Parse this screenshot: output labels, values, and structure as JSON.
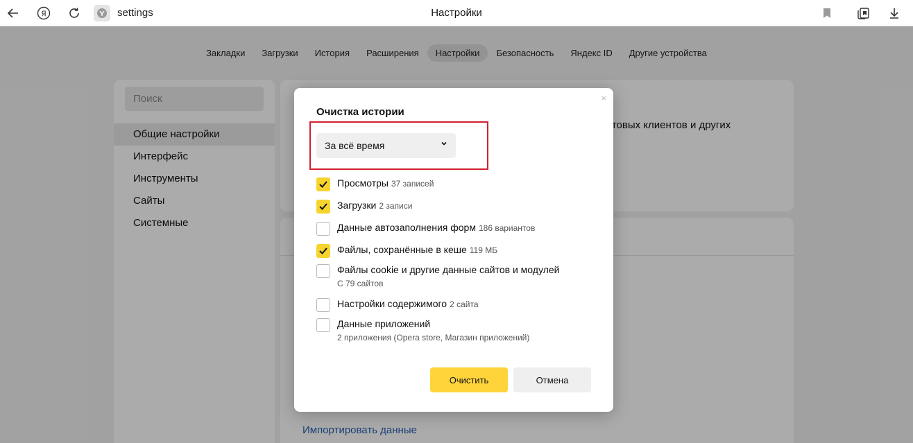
{
  "browser": {
    "address": "settings",
    "page_title": "Настройки"
  },
  "nav": {
    "items": [
      "Закладки",
      "Загрузки",
      "История",
      "Расширения",
      "Настройки",
      "Безопасность",
      "Яндекс ID",
      "Другие устройства"
    ],
    "active": "Настройки"
  },
  "sidebar": {
    "search_placeholder": "Поиск",
    "items": [
      "Общие настройки",
      "Интерфейс",
      "Инструменты",
      "Сайты",
      "Системные"
    ]
  },
  "background": {
    "panel1_text": "чтовых клиентов и других",
    "import_link": "Импортировать данные"
  },
  "dialog": {
    "close": "×",
    "title": "Очистка истории",
    "period_value": "За всё время",
    "options": [
      {
        "label": "Просмотры",
        "count": "37 записей",
        "sub": "",
        "checked": true
      },
      {
        "label": "Загрузки",
        "count": "2 записи",
        "sub": "",
        "checked": true
      },
      {
        "label": "Данные автозаполнения форм",
        "count": "186 вариантов",
        "sub": "",
        "checked": false
      },
      {
        "label": "Файлы, сохранённые в кеше",
        "count": "119 МБ",
        "sub": "",
        "checked": true
      },
      {
        "label": "Файлы cookie и другие данные сайтов и модулей",
        "count": "",
        "sub": "С 79 сайтов",
        "checked": false
      },
      {
        "label": "Настройки содержимого",
        "count": "2 сайта",
        "sub": "",
        "checked": false
      },
      {
        "label": "Данные приложений",
        "count": "",
        "sub": "2 приложения (Opera store, Магазин приложений)",
        "checked": false
      }
    ],
    "confirm_label": "Очистить",
    "cancel_label": "Отмена"
  },
  "colors": {
    "accent": "#ffd43b",
    "highlight": "#d2202f",
    "link": "#2a5fb0"
  }
}
